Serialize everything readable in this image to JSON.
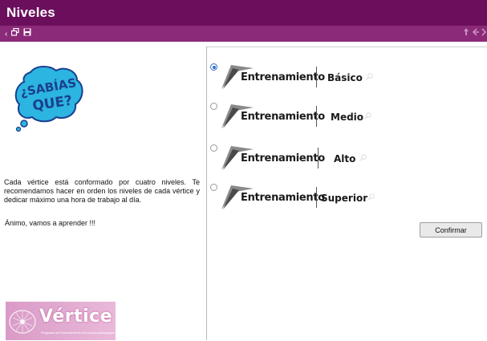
{
  "window": {
    "title": "Niveles"
  },
  "toolbar": {
    "icons": [
      "chevron-left-icon",
      "restore-window-icon",
      "save-icon",
      "pin-icon",
      "back-icon",
      "forward-icon"
    ]
  },
  "left": {
    "bubble": {
      "line1": "¿SABÍAS",
      "line2": "QUE?"
    },
    "description": "Cada vértice está conformado por cuatro niveles. Te recomendamos hacer en orden los niveles de cada vértice y dedicar máximo una hora de trabajo al día.",
    "cheer": "Ánimo, vamos a aprender !!!",
    "logo": {
      "word": "Vértice",
      "tagline": "Programa de Entrenamiento Neuropsicopedagógico"
    }
  },
  "options": [
    {
      "label": "Entrenamiento",
      "level": "Básico",
      "selected": true
    },
    {
      "label": "Entrenamiento",
      "level": "Medio",
      "selected": false
    },
    {
      "label": "Entrenamiento",
      "level": "Alto",
      "selected": false
    },
    {
      "label": "Entrenamiento",
      "level": "Superior",
      "selected": false
    }
  ],
  "confirm_label": "Confirmar",
  "colors": {
    "titlebar": "#6b0f5c",
    "toolbar": "#8a2a78",
    "bubble": "#2bb5e0",
    "bubble_text": "#1b3f8f",
    "logo": "#d99bc7",
    "radio_selected": "#2f6fcf"
  }
}
